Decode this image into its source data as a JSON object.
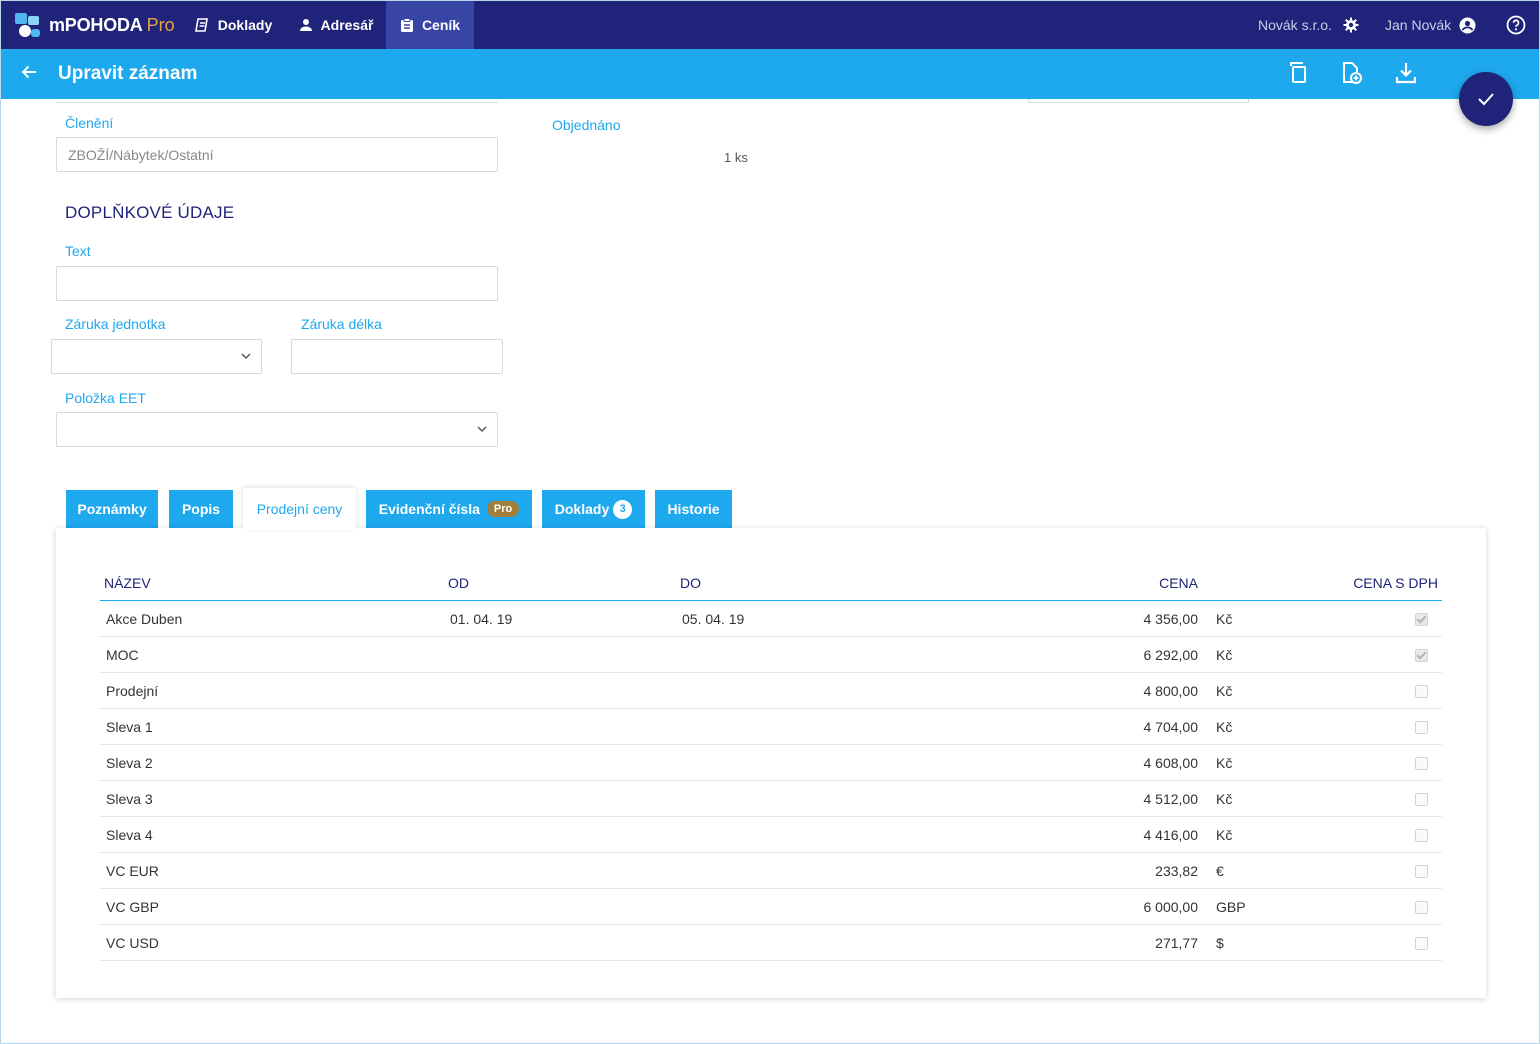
{
  "app": {
    "name": "mPOHODA",
    "edition": "Pro"
  },
  "nav": {
    "items": [
      {
        "label": "Doklady"
      },
      {
        "label": "Adresář"
      },
      {
        "label": "Ceník"
      }
    ],
    "company": "Novák s.r.o.",
    "user": "Jan Novák"
  },
  "actionbar": {
    "title": "Upravit záznam"
  },
  "form": {
    "cleneni_label": "Členění",
    "cleneni_value": "ZBOŽÍ/Nábytek/Ostatní",
    "objednano_label": "Objednáno",
    "objednano_value": "1 ks",
    "section_title": "DOPLŇKOVÉ ÚDAJE",
    "text_label": "Text",
    "text_value": "",
    "zaruka_jednotka_label": "Záruka jednotka",
    "zaruka_jednotka_value": "",
    "zaruka_delka_label": "Záruka délka",
    "zaruka_delka_value": "",
    "polozka_eet_label": "Položka EET",
    "polozka_eet_value": ""
  },
  "tabs": [
    {
      "label": "Poznámky"
    },
    {
      "label": "Popis"
    },
    {
      "label": "Prodejní ceny",
      "active": true
    },
    {
      "label": "Evidenční čísla",
      "badge": "Pro"
    },
    {
      "label": "Doklady",
      "count": "3"
    },
    {
      "label": "Historie"
    }
  ],
  "prices": {
    "columns": [
      "NÁZEV",
      "OD",
      "DO",
      "CENA",
      "CENA S DPH"
    ],
    "rows": [
      {
        "name": "Akce Duben",
        "from": "01. 04. 19",
        "to": "05. 04. 19",
        "price": "4 356,00",
        "currency": "Kč",
        "with_vat": true
      },
      {
        "name": "MOC",
        "from": "",
        "to": "",
        "price": "6 292,00",
        "currency": "Kč",
        "with_vat": true
      },
      {
        "name": "Prodejní",
        "from": "",
        "to": "",
        "price": "4 800,00",
        "currency": "Kč",
        "with_vat": false
      },
      {
        "name": "Sleva 1",
        "from": "",
        "to": "",
        "price": "4 704,00",
        "currency": "Kč",
        "with_vat": false
      },
      {
        "name": "Sleva 2",
        "from": "",
        "to": "",
        "price": "4 608,00",
        "currency": "Kč",
        "with_vat": false
      },
      {
        "name": "Sleva 3",
        "from": "",
        "to": "",
        "price": "4 512,00",
        "currency": "Kč",
        "with_vat": false
      },
      {
        "name": "Sleva 4",
        "from": "",
        "to": "",
        "price": "4 416,00",
        "currency": "Kč",
        "with_vat": false
      },
      {
        "name": "VC EUR",
        "from": "",
        "to": "",
        "price": "233,82",
        "currency": "€",
        "with_vat": false
      },
      {
        "name": "VC GBP",
        "from": "",
        "to": "",
        "price": "6 000,00",
        "currency": "GBP",
        "with_vat": false
      },
      {
        "name": "VC USD",
        "from": "",
        "to": "",
        "price": "271,77",
        "currency": "$",
        "with_vat": false
      }
    ]
  },
  "colors": {
    "navy": "#1f237a",
    "accent": "#1ea8ee",
    "active_nav": "#3945a5",
    "pro_gold": "#e5a545"
  }
}
